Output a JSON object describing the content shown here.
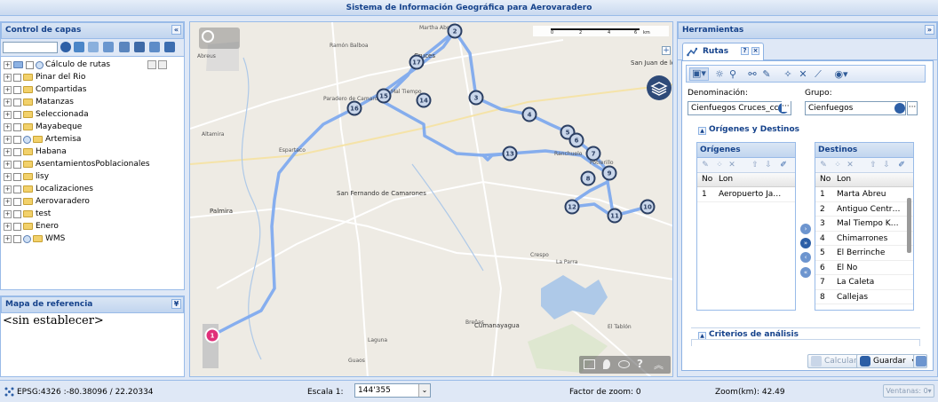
{
  "app": {
    "title": "Sistema de Información Geográfica para Aerovaradero"
  },
  "layers_panel": {
    "title": "Control de capas",
    "search_placeholder": "",
    "layers": [
      {
        "label": "Cálculo de rutas",
        "visible": true
      },
      {
        "label": "Pinar del Rio",
        "visible": false
      },
      {
        "label": "Compartidas",
        "visible": false
      },
      {
        "label": "Matanzas",
        "visible": false
      },
      {
        "label": "Seleccionada",
        "visible": false
      },
      {
        "label": "Mayabeque",
        "visible": false
      },
      {
        "label": "Artemisa",
        "visible": true
      },
      {
        "label": "Habana",
        "visible": false
      },
      {
        "label": "AsentamientosPoblacionales",
        "visible": false
      },
      {
        "label": "lisy",
        "visible": false
      },
      {
        "label": "Localizaciones",
        "visible": false
      },
      {
        "label": "Aerovaradero",
        "visible": false
      },
      {
        "label": "test",
        "visible": false
      },
      {
        "label": "Enero",
        "visible": false
      },
      {
        "label": "WMS",
        "visible": true
      }
    ]
  },
  "reference_map": {
    "title": "Mapa de referencia",
    "text": "<sin establecer>"
  },
  "map": {
    "scale_labels": [
      "0",
      "2",
      "4",
      "6",
      "km"
    ],
    "places": [
      {
        "name": "Martha Abreu"
      },
      {
        "name": "Ramón Balboa"
      },
      {
        "name": "Abreus"
      },
      {
        "name": "Cruces"
      },
      {
        "name": "San Juan de los Yeras"
      },
      {
        "name": "Paradero de Camarones"
      },
      {
        "name": "Mal Tiempo"
      },
      {
        "name": "Ranchuelo"
      },
      {
        "name": "Altamira"
      },
      {
        "name": "Espartaco"
      },
      {
        "name": "Palmira"
      },
      {
        "name": "San Fernando de Camarones"
      },
      {
        "name": "Potrerillo"
      },
      {
        "name": "Crespo"
      },
      {
        "name": "La Parra"
      },
      {
        "name": "Cumanayagua"
      },
      {
        "name": "Breñas"
      },
      {
        "name": "El Tablón"
      },
      {
        "name": "Guaos"
      },
      {
        "name": "Laguna"
      }
    ],
    "route_markers": [
      "1",
      "2",
      "3",
      "4",
      "5",
      "6",
      "7",
      "8",
      "9",
      "10",
      "11",
      "12",
      "13",
      "14",
      "15",
      "16",
      "17"
    ],
    "colors": {
      "route": "#7aa7ef",
      "marker_origin": "#e0307a",
      "marker": "#2b3f63",
      "water": "#aec9e8"
    }
  },
  "tools_panel": {
    "title": "Herramientas",
    "tab": {
      "label": "Rutas"
    },
    "denominacion_label": "Denominación:",
    "denominacion_value": "Cienfuegos Cruces_cc",
    "grupo_label": "Grupo:",
    "grupo_value": "Cienfuegos",
    "section_od": "Orígenes y Destinos",
    "origins": {
      "title": "Orígenes",
      "col_no": "No",
      "col_lon": "Lon",
      "rows": [
        {
          "no": "1",
          "lon": "Aeropuerto Jai..."
        }
      ]
    },
    "destinations": {
      "title": "Destinos",
      "col_no": "No",
      "col_lon": "Lon",
      "rows": [
        {
          "no": "1",
          "lon": "Marta Abreu"
        },
        {
          "no": "2",
          "lon": "Antiguo Central..."
        },
        {
          "no": "3",
          "lon": "Mal Tiempo Kil..."
        },
        {
          "no": "4",
          "lon": "Chimarrones"
        },
        {
          "no": "5",
          "lon": "El Berrinche"
        },
        {
          "no": "6",
          "lon": "El No"
        },
        {
          "no": "7",
          "lon": "La Caleta"
        },
        {
          "no": "8",
          "lon": "Callejas"
        }
      ]
    },
    "section_criteria": "Criterios de análisis",
    "calcular_label": "Calcular",
    "guardar_label": "Guardar"
  },
  "status": {
    "coords": "EPSG:4326 :-80.38096 / 22.20334",
    "scale_label": "Escala 1:",
    "scale_value": "144'355",
    "zoom_factor": "Factor de zoom: 0",
    "zoom_km": "Zoom(km): 42.49",
    "ventanas": "Ventanas: 0"
  }
}
